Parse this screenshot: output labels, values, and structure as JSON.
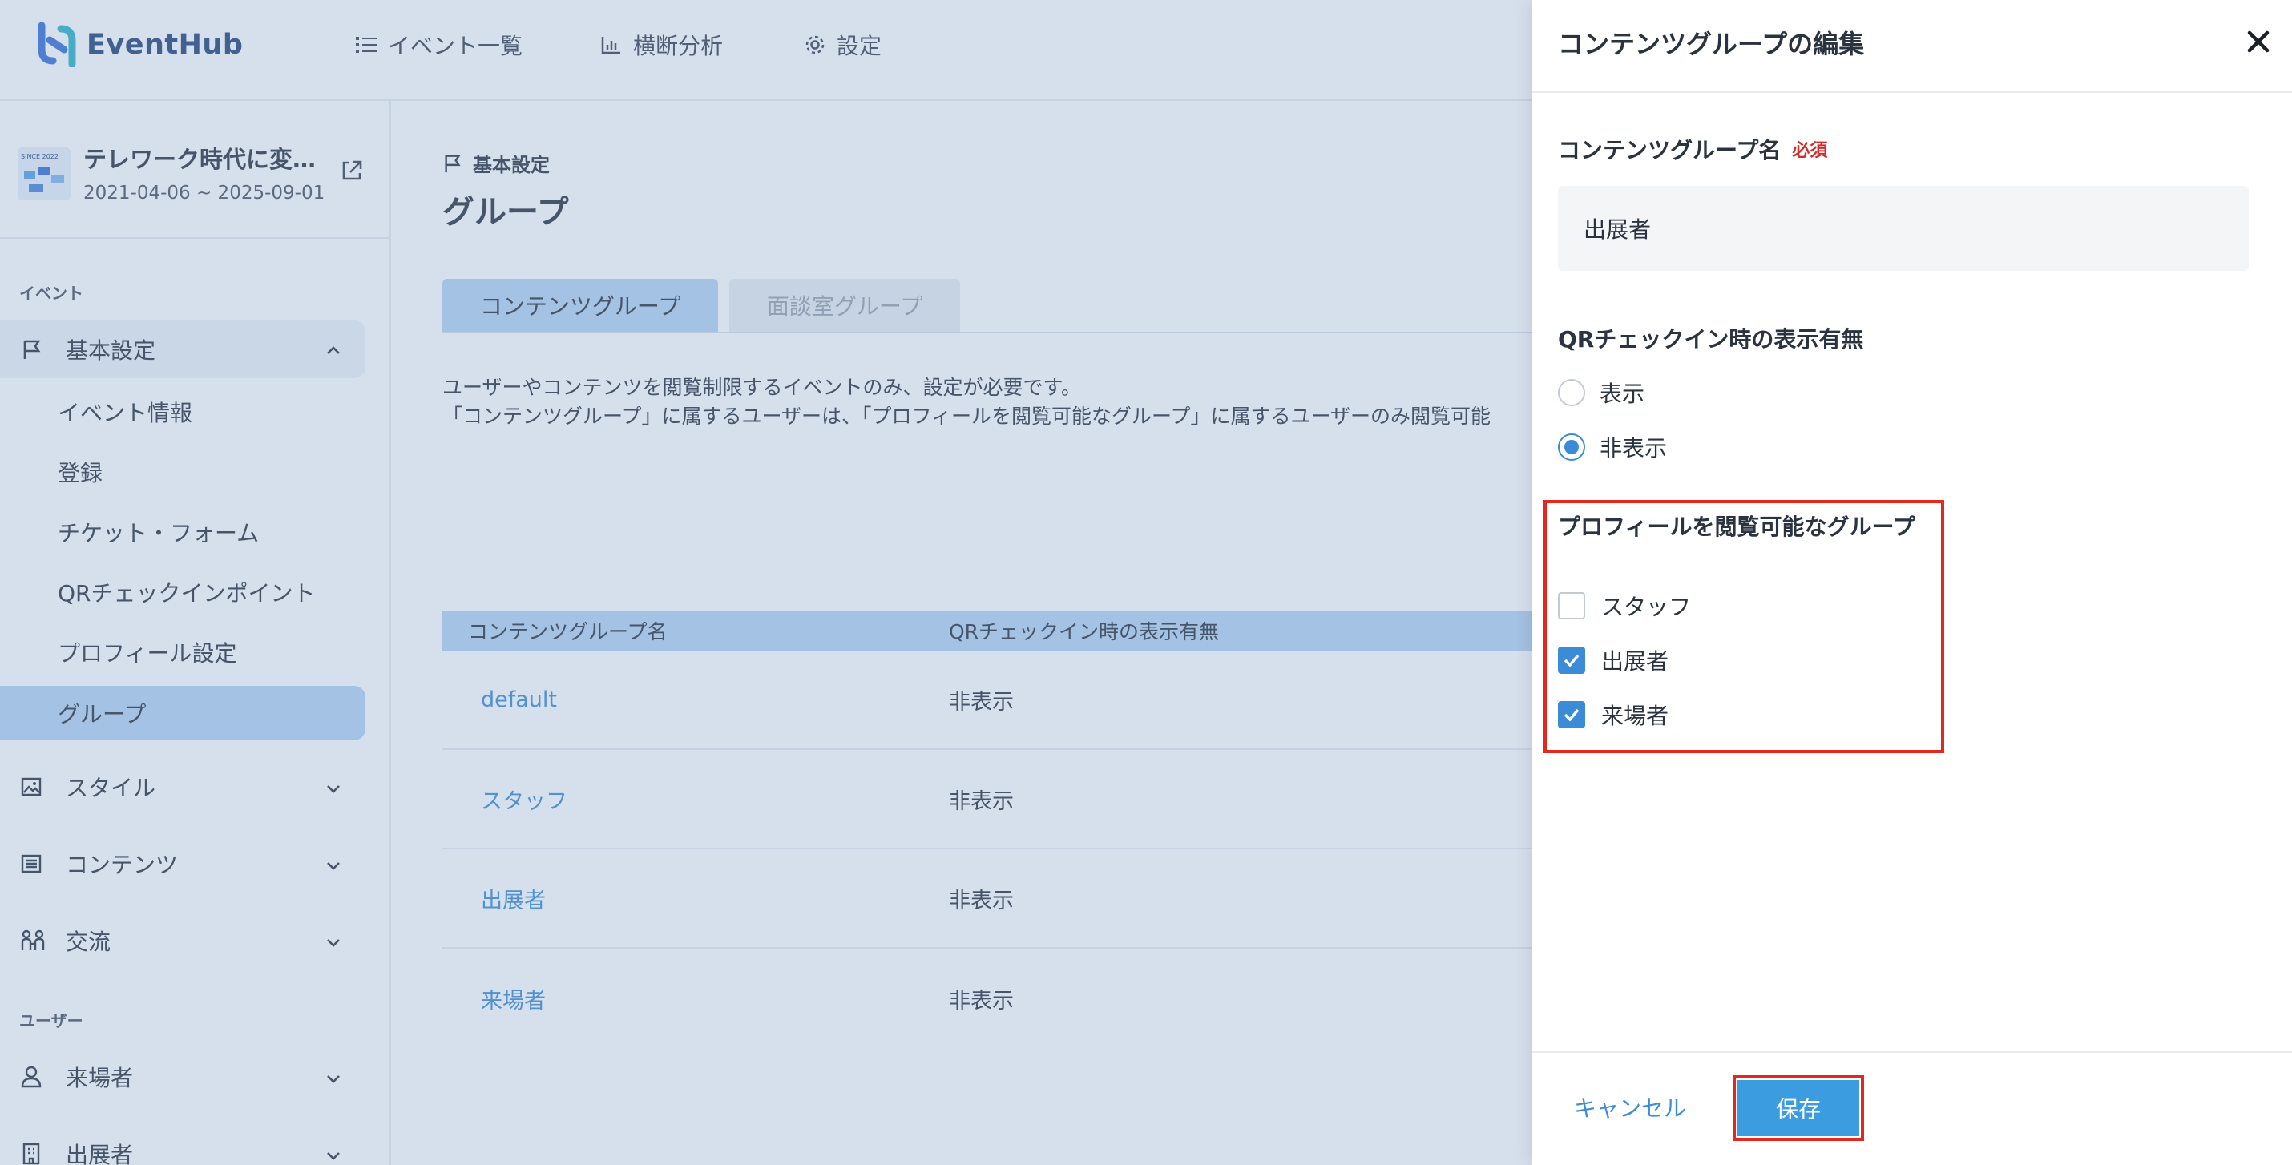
{
  "app": {
    "name": "EventHub",
    "nav": [
      {
        "label": "イベント一覧",
        "icon": "list-icon"
      },
      {
        "label": "横断分析",
        "icon": "bar-chart-icon"
      },
      {
        "label": "設定",
        "icon": "gear-icon"
      }
    ]
  },
  "event": {
    "title": "テレワーク時代に変わるイベント",
    "dates": "2021-04-06 ~ 2025-09-01",
    "thumb_text": "SINCE 2022"
  },
  "sidebar": {
    "section_event": "イベント",
    "basic_settings": "基本設定",
    "sub_items": [
      "イベント情報",
      "登録",
      "チケット・フォーム",
      "QRチェックインポイント",
      "プロフィール設定"
    ],
    "active_item": "グループ",
    "style": "スタイル",
    "contents": "コンテンツ",
    "exchange": "交流",
    "section_user": "ユーザー",
    "visitors": "来場者",
    "exhibitors": "出展者"
  },
  "main": {
    "breadcrumb": "基本設定",
    "title": "グループ",
    "tab_contents": "コンテンツグループ",
    "tab_meeting": "面談室グループ",
    "desc_line1": "ユーザーやコンテンツを閲覧制限するイベントのみ、設定が必要です。",
    "desc_line2": "「コンテンツグループ」に属するユーザーは、「プロフィールを閲覧可能なグループ」に属するユーザーのみ閲覧可能",
    "table": {
      "headers": [
        "コンテンツグループ名",
        "QRチェックイン時の表示有無"
      ],
      "rows": [
        {
          "name": "default",
          "qr": "非表示"
        },
        {
          "name": "スタッフ",
          "qr": "非表示"
        },
        {
          "name": "出展者",
          "qr": "非表示"
        },
        {
          "name": "来場者",
          "qr": "非表示"
        }
      ]
    }
  },
  "drawer": {
    "title": "コンテンツグループの編集",
    "name_label": "コンテンツグループ名",
    "required": "必須",
    "name_value": "出展者",
    "qr_label": "QRチェックイン時の表示有無",
    "qr_options": [
      {
        "label": "表示",
        "selected": false
      },
      {
        "label": "非表示",
        "selected": true
      }
    ],
    "profile_label": "プロフィールを閲覧可能なグループ",
    "profile_groups": [
      {
        "label": "スタッフ",
        "checked": false
      },
      {
        "label": "出展者",
        "checked": true
      },
      {
        "label": "来場者",
        "checked": true
      }
    ],
    "cancel": "キャンセル",
    "save": "保存"
  },
  "colors": {
    "accent": "#3b8bd6",
    "highlight": "#e5281d",
    "active_bg": "#b5d3f2",
    "required": "#d62b2b"
  }
}
